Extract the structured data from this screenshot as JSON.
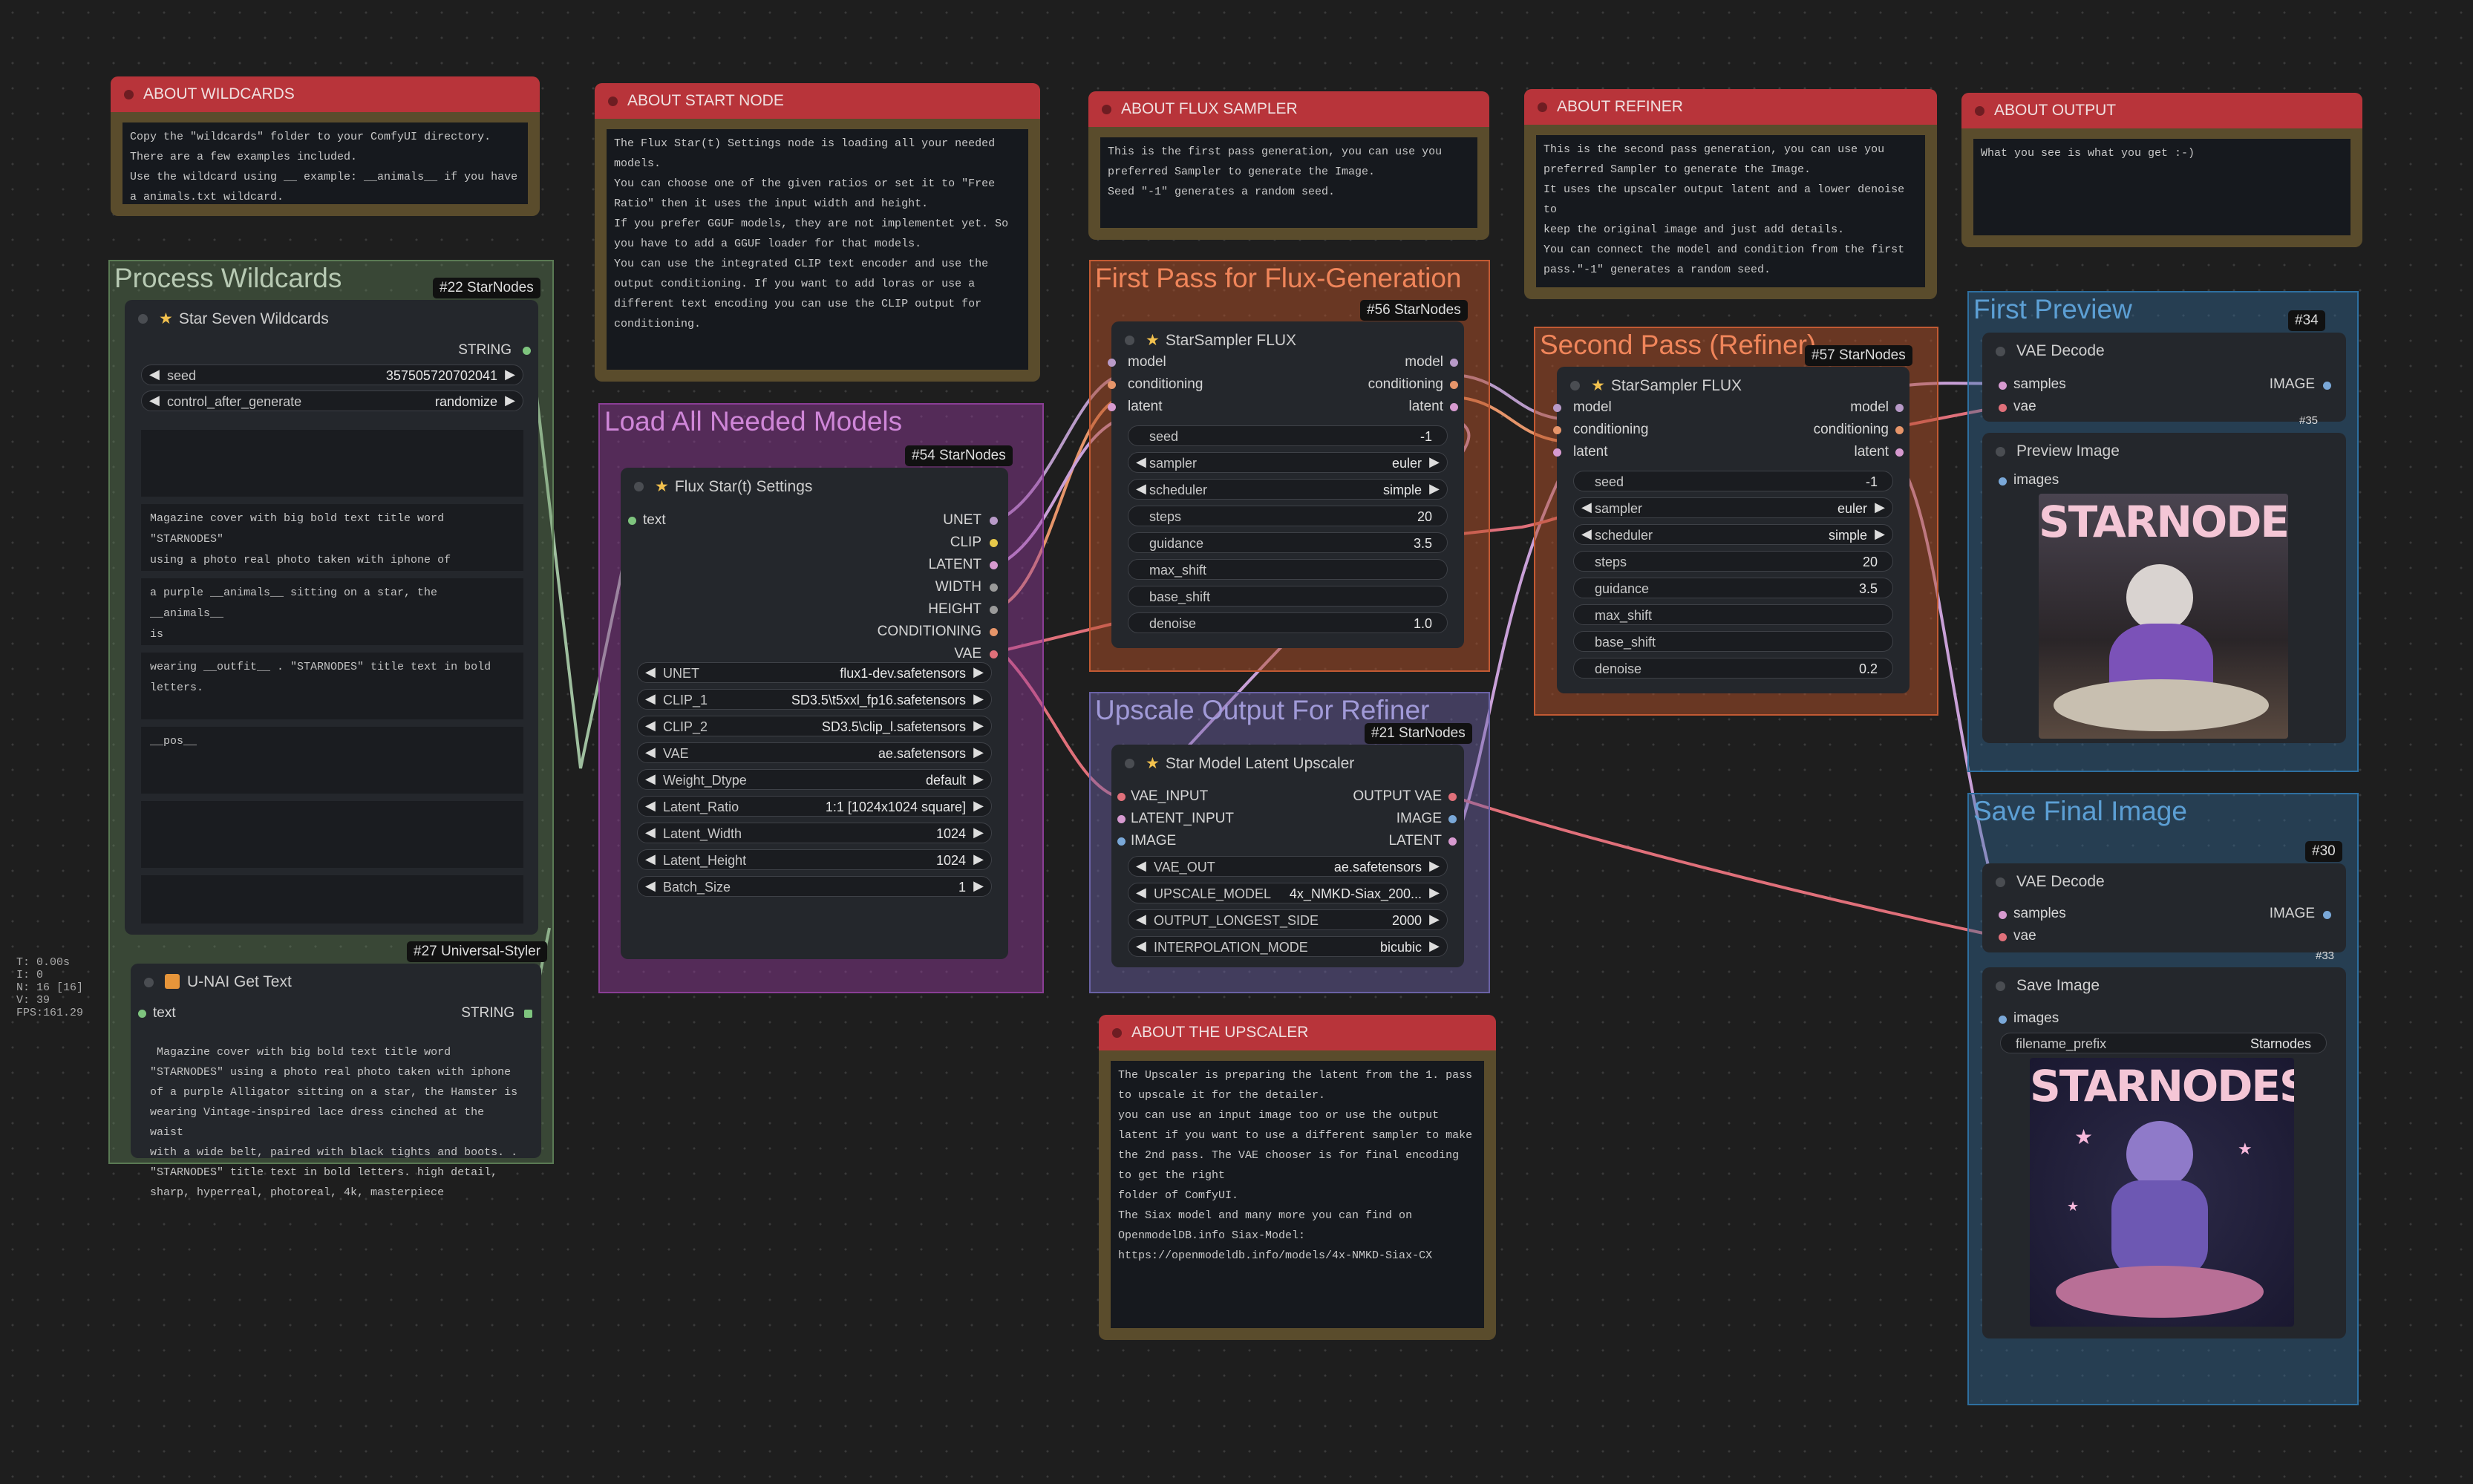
{
  "colors": {
    "canvas": "#1e1e1e",
    "note_header": "#b8343a",
    "note_frame": "#5a4c2c",
    "node_bg": "#24272c",
    "wire_pink": "#e0707a",
    "wire_purple": "#b89ac8",
    "wire_orange": "#e6956a",
    "wire_green": "#9fbf9f"
  },
  "groups": {
    "process_wildcards": "Process Wildcards",
    "load_models": "Load All Needed Models",
    "first_pass": "First Pass for Flux-Generation",
    "second_pass": "Second Pass (Refiner)",
    "upscale": "Upscale Output For Refiner",
    "first_preview": "First Preview",
    "save_final": "Save Final Image"
  },
  "notes": {
    "wildcards": {
      "title": "ABOUT WILDCARDS",
      "body": "Copy the \"wildcards\" folder to your ComfyUI directory.\nThere are a few examples included.\nUse the wildcard using __ example: __animals__ if you have\na animals.txt wildcard."
    },
    "start_node": {
      "title": "ABOUT START NODE",
      "body": "The Flux Star(t) Settings node is loading all your needed\nmodels.\nYou can choose one of the given ratios or set it to \"Free\nRatio\" then it uses the input width and height.\nIf you prefer GGUF models, they are not implementet yet. So\nyou have to add a GGUF loader for that models.\nYou can use the integrated CLIP text encoder and use the\noutput conditioning. If you want to add loras or use a\ndifferent text encoding you can use the CLIP output for\nconditioning."
    },
    "flux_sampler": {
      "title": "ABOUT FLUX SAMPLER",
      "body": "This is the first pass generation, you can use you\npreferred Sampler to generate the Image.\nSeed \"-1\" generates a random seed."
    },
    "refiner": {
      "title": "ABOUT REFINER",
      "body": "This is the second pass generation, you can use you\npreferred Sampler to generate the Image.\nIt uses the upscaler output latent and a lower denoise to\nkeep the original image and just add details.\nYou can connect the model and condition from the first\npass.\"-1\" generates a random seed."
    },
    "output": {
      "title": "ABOUT OUTPUT",
      "body": "What you see is what you get :-)"
    },
    "upscaler": {
      "title": "ABOUT THE UPSCALER",
      "body": "The Upscaler is preparing the latent from the 1. pass\nto upscale it for the detailer.\nyou can use an input image too or use the output\nlatent if you want to use a different sampler to make\nthe 2nd pass. The VAE chooser is for final encoding to get the right\nfolder of ComfyUI.\nThe Siax model and many more you can find on\nOpenmodelDB.info Siax-Model:\nhttps://openmodeldb.info/models/4x-NMKD-Siax-CX"
    }
  },
  "wildcards_node": {
    "badge": "#22 StarNodes",
    "title": "Star Seven Wildcards",
    "output_label": "STRING",
    "seed_label": "seed",
    "seed_value": "357505720702041",
    "cag_label": "control_after_generate",
    "cag_value": "randomize",
    "prompts": [
      "Magazine cover with big bold text title word \"STARNODES\"\nusing a photo real photo taken with iphone of",
      "a purple __animals__ sitting on a star, the __animals__\nis",
      "wearing __outfit__ . \"STARNODES\" title text in bold\nletters.",
      "__pos__"
    ]
  },
  "get_text_node": {
    "badge": "#27 Universal-Styler",
    "title": "U-NAI Get Text",
    "input_label": "text",
    "output_label": "STRING",
    "text": " Magazine cover with big bold text title word\n\"STARNODES\" using a photo real photo taken with iphone\nof a purple Alligator sitting on a star, the Hamster is\nwearing Vintage-inspired lace dress cinched at the waist\nwith a wide belt, paired with black tights and boots. .\n\"STARNODES\" title text in bold letters. high detail,\nsharp, hyperreal, photoreal, 4k, masterpiece"
  },
  "settings_node": {
    "badge": "#54 StarNodes",
    "title": "Flux Star(t) Settings",
    "input_label": "text",
    "outputs": [
      "UNET",
      "CLIP",
      "LATENT",
      "WIDTH",
      "HEIGHT",
      "CONDITIONING",
      "VAE"
    ],
    "widgets": [
      {
        "label": "UNET",
        "value": "flux1-dev.safetensors"
      },
      {
        "label": "CLIP_1",
        "value": "SD3.5\\t5xxl_fp16.safetensors"
      },
      {
        "label": "CLIP_2",
        "value": "SD3.5\\clip_l.safetensors"
      },
      {
        "label": "VAE",
        "value": "ae.safetensors"
      },
      {
        "label": "Weight_Dtype",
        "value": "default"
      },
      {
        "label": "Latent_Ratio",
        "value": "1:1 [1024x1024 square]"
      },
      {
        "label": "Latent_Width",
        "value": "1024"
      },
      {
        "label": "Latent_Height",
        "value": "1024"
      },
      {
        "label": "Batch_Size",
        "value": "1"
      }
    ]
  },
  "sampler1": {
    "badge": "#56 StarNodes",
    "title": "StarSampler FLUX",
    "inputs": [
      "model",
      "conditioning",
      "latent"
    ],
    "outputs": [
      "model",
      "conditioning",
      "latent"
    ],
    "widgets": [
      {
        "label": "seed",
        "value": "-1",
        "arrows": false
      },
      {
        "label": "sampler",
        "value": "euler",
        "arrows": true
      },
      {
        "label": "scheduler",
        "value": "simple",
        "arrows": true
      },
      {
        "label": "steps",
        "value": "20",
        "arrows": false
      },
      {
        "label": "guidance",
        "value": "3.5",
        "arrows": false
      },
      {
        "label": "max_shift",
        "value": "",
        "arrows": false
      },
      {
        "label": "base_shift",
        "value": "",
        "arrows": false
      },
      {
        "label": "denoise",
        "value": "1.0",
        "arrows": false
      }
    ]
  },
  "sampler2": {
    "badge": "#57 StarNodes",
    "title": "StarSampler FLUX",
    "inputs": [
      "model",
      "conditioning",
      "latent"
    ],
    "outputs": [
      "model",
      "conditioning",
      "latent"
    ],
    "widgets": [
      {
        "label": "seed",
        "value": "-1",
        "arrows": false
      },
      {
        "label": "sampler",
        "value": "euler",
        "arrows": true
      },
      {
        "label": "scheduler",
        "value": "simple",
        "arrows": true
      },
      {
        "label": "steps",
        "value": "20",
        "arrows": false
      },
      {
        "label": "guidance",
        "value": "3.5",
        "arrows": false
      },
      {
        "label": "max_shift",
        "value": "",
        "arrows": false
      },
      {
        "label": "base_shift",
        "value": "",
        "arrows": false
      },
      {
        "label": "denoise",
        "value": "0.2",
        "arrows": false
      }
    ]
  },
  "upscaler_node": {
    "badge": "#21 StarNodes",
    "title": "Star Model Latent Upscaler",
    "inputs": [
      "VAE_INPUT",
      "LATENT_INPUT",
      "IMAGE"
    ],
    "outputs": [
      "OUTPUT VAE",
      "IMAGE",
      "LATENT"
    ],
    "widgets": [
      {
        "label": "VAE_OUT",
        "value": "ae.safetensors"
      },
      {
        "label": "UPSCALE_MODEL",
        "value": "4x_NMKD-Siax_200..."
      },
      {
        "label": "OUTPUT_LONGEST_SIDE",
        "value": "2000"
      },
      {
        "label": "INTERPOLATION_MODE",
        "value": "bicubic"
      }
    ]
  },
  "first_preview": {
    "badge": "#34",
    "badge2": "#35",
    "vae_title": "VAE Decode",
    "inputs": [
      "samples",
      "vae"
    ],
    "output_label": "IMAGE",
    "preview_title": "Preview Image",
    "images_label": "images",
    "image_text": "STARNODES"
  },
  "save_final": {
    "badge": "#30",
    "badge2": "#33",
    "vae_title": "VAE Decode",
    "inputs": [
      "samples",
      "vae"
    ],
    "output_label": "IMAGE",
    "save_title": "Save Image",
    "images_label": "images",
    "prefix_label": "filename_prefix",
    "prefix_value": "Starnodes",
    "image_text": "STARNODES"
  },
  "stats": {
    "t": "T: 0.00s",
    "i": "I: 0",
    "n": "N: 16 [16]",
    "v": "V: 39",
    "fps": "FPS:161.29"
  }
}
